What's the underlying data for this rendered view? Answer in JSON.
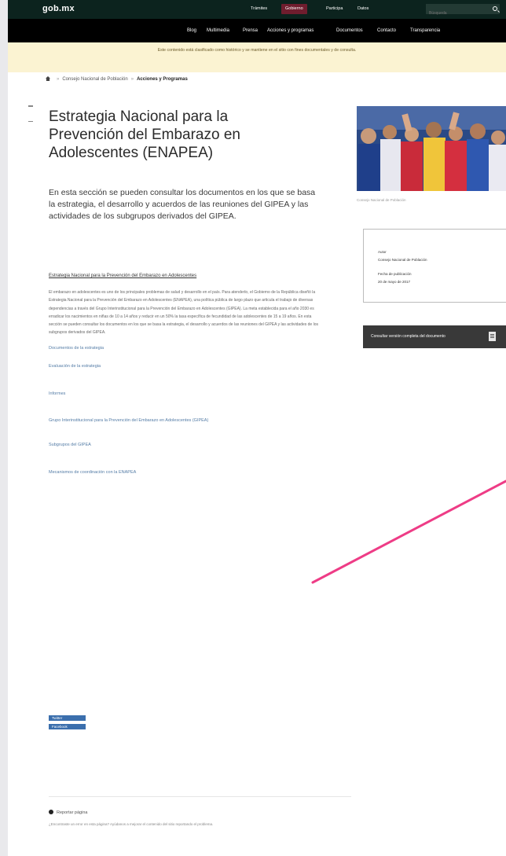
{
  "header": {
    "logo": "gob.mx",
    "top_nav": [
      {
        "label": "Trámites",
        "active": false
      },
      {
        "label": "Gobierno",
        "active": true
      },
      {
        "label": "Participa",
        "active": false
      },
      {
        "label": "Datos",
        "active": false
      }
    ],
    "search_placeholder": "Búsqueda",
    "sub_nav": [
      "Blog",
      "Multimedia",
      "Prensa",
      "Acciones y programas",
      "Documentos",
      "Contacto",
      "Transparencia"
    ]
  },
  "notice": "Este contenido está clasificado como histórico y se mantiene en el sitio con fines documentales y de consulta.",
  "breadcrumb": {
    "parent": "Consejo Nacional de Población",
    "current": "Acciones y Programas"
  },
  "main": {
    "title": "Estrategia Nacional para la Prevención del Embarazo en Adolescentes (ENAPEA)",
    "lead": "En esta sección se pueden consultar los documentos en los que se basa la estrategia, el desarrollo y acuerdos de las reuniones del GIPEA  y las actividades de los subgrupos derivados del GIPEA.",
    "section_heading": "Estrategia Nacional para la Prevención del Embarazo en Adolescentes",
    "paragraph": "El embarazo en adolescentes es uno de los principales problemas de salud y desarrollo en el país. Para atenderlo, el Gobierno de la República diseñó la Estrategia Nacional para la Prevención del Embarazo en Adolescentes (ENAPEA), una política pública de largo plazo que articula el trabajo de diversas dependencias a través del Grupo Interinstitucional para la Prevención del Embarazo en Adolescentes (GIPEA). La meta establecida para el año 2030 es erradicar los nacimientos en niñas de 10 a 14 años y reducir en un 50% la tasa específica de fecundidad de las adolescentes de 15 a 19 años. En esta sección se pueden consultar los documentos en los que se basa la estrategia, el desarrollo y acuerdos de las reuniones del GIPEA y las actividades de los subgrupos derivados del GIPEA.",
    "links": [
      "Documentos de la estrategia",
      "Evaluación de la estrategia",
      "Informes",
      "Grupo Interinstitucional para la Prevención del Embarazo en Adolescentes (GIPEA)",
      "Subgrupos del GIPEA",
      "Mecanismos de coordinación con la ENAPEA"
    ],
    "share": [
      "Twitter",
      "Facebook"
    ],
    "report_label": "Reportar página",
    "report_description": "¿Encontraste un error en esta página? Ayúdanos a mejorar el contenido del sitio reportando el problema."
  },
  "sidebar": {
    "photo_caption": "Consejo Nacional de Población",
    "info_author_label": "Autor",
    "info_author": "Consejo Nacional de Población",
    "info_date_label": "Fecha de publicación",
    "info_date": "20 de mayo de 2017",
    "download_label": "Consultar versión completa del documento"
  },
  "colors": {
    "topbar": "#0c231e",
    "active_nav": "#6f1d2e",
    "link": "#547ca6",
    "notice_bg": "#fbf3d2",
    "annotation_arrow": "#ee3c86"
  }
}
